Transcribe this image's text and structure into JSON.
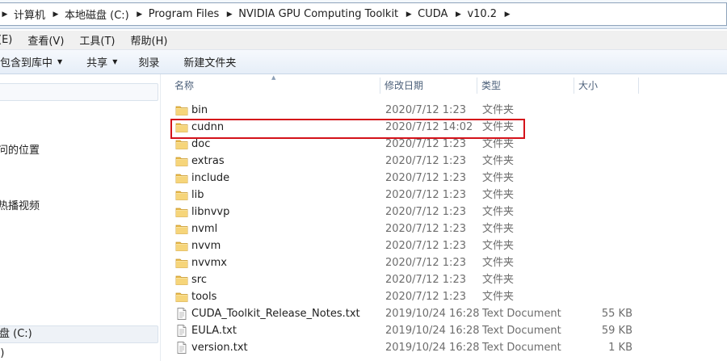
{
  "address": {
    "crumbs": [
      "计算机",
      "本地磁盘 (C:)",
      "Program Files",
      "NVIDIA GPU Computing Toolkit",
      "CUDA",
      "v10.2"
    ]
  },
  "menu": {
    "items": [
      "(E)",
      "查看(V)",
      "工具(T)",
      "帮助(H)"
    ]
  },
  "toolbar": {
    "include_library": "包含到库中",
    "share": "共享",
    "burn": "刻录",
    "new_folder": "新建文件夹"
  },
  "sidebar": {
    "recent_places": "问的位置",
    "hot_videos": "热播视频",
    "drive_c": "盘 (C:)",
    "drive_d": ":)"
  },
  "columns": {
    "name": "名称",
    "date_modified": "修改日期",
    "type": "类型",
    "size": "大小"
  },
  "files": [
    {
      "name": "bin",
      "date": "2020/7/12 1:23",
      "type": "文件夹",
      "size": "",
      "kind": "folder"
    },
    {
      "name": "cudnn",
      "date": "2020/7/12 14:02",
      "type": "文件夹",
      "size": "",
      "kind": "folder"
    },
    {
      "name": "doc",
      "date": "2020/7/12 1:23",
      "type": "文件夹",
      "size": "",
      "kind": "folder"
    },
    {
      "name": "extras",
      "date": "2020/7/12 1:23",
      "type": "文件夹",
      "size": "",
      "kind": "folder"
    },
    {
      "name": "include",
      "date": "2020/7/12 1:23",
      "type": "文件夹",
      "size": "",
      "kind": "folder"
    },
    {
      "name": "lib",
      "date": "2020/7/12 1:23",
      "type": "文件夹",
      "size": "",
      "kind": "folder"
    },
    {
      "name": "libnvvp",
      "date": "2020/7/12 1:23",
      "type": "文件夹",
      "size": "",
      "kind": "folder"
    },
    {
      "name": "nvml",
      "date": "2020/7/12 1:23",
      "type": "文件夹",
      "size": "",
      "kind": "folder"
    },
    {
      "name": "nvvm",
      "date": "2020/7/12 1:23",
      "type": "文件夹",
      "size": "",
      "kind": "folder"
    },
    {
      "name": "nvvmx",
      "date": "2020/7/12 1:23",
      "type": "文件夹",
      "size": "",
      "kind": "folder"
    },
    {
      "name": "src",
      "date": "2020/7/12 1:23",
      "type": "文件夹",
      "size": "",
      "kind": "folder"
    },
    {
      "name": "tools",
      "date": "2020/7/12 1:23",
      "type": "文件夹",
      "size": "",
      "kind": "folder"
    },
    {
      "name": "CUDA_Toolkit_Release_Notes.txt",
      "date": "2019/10/24 16:28",
      "type": "Text Document",
      "size": "55 KB",
      "kind": "text"
    },
    {
      "name": "EULA.txt",
      "date": "2019/10/24 16:28",
      "type": "Text Document",
      "size": "59 KB",
      "kind": "text"
    },
    {
      "name": "version.txt",
      "date": "2019/10/24 16:28",
      "type": "Text Document",
      "size": "1 KB",
      "kind": "text"
    }
  ],
  "highlighted_item": "cudnn",
  "colors": {
    "highlight_border": "#d4121a",
    "folder": "#e9b949"
  }
}
